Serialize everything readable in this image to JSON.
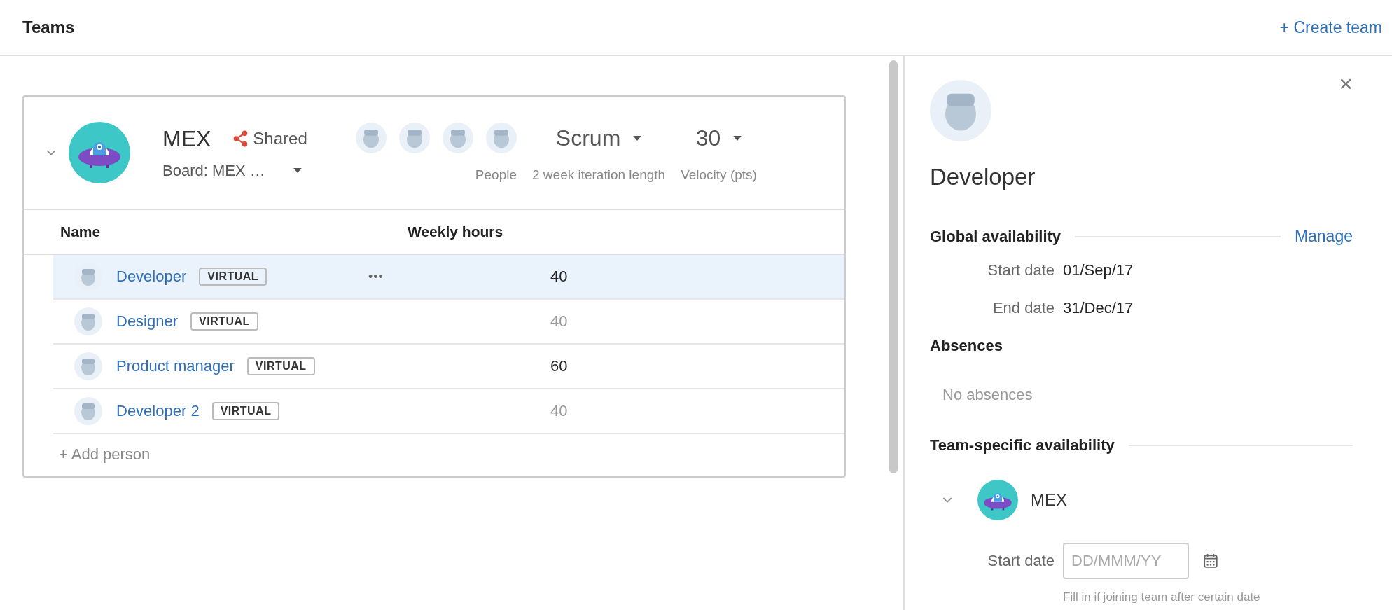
{
  "header": {
    "title": "Teams",
    "create_button": "+ Create team"
  },
  "team": {
    "name": "MEX",
    "expanded": true,
    "shared_label": "Shared",
    "board": "Board: MEX …",
    "people_label": "People",
    "method": "Scrum",
    "method_label": "2 week iteration length",
    "velocity": "30",
    "velocity_label": "Velocity (pts)",
    "columns": [
      "Name",
      "Weekly hours"
    ],
    "rows": [
      {
        "name": "Developer",
        "tag": "VIRTUAL",
        "actions": "•••",
        "hours": "40",
        "muted": false,
        "selected": true
      },
      {
        "name": "Designer",
        "tag": "VIRTUAL",
        "hours": "40",
        "muted": true,
        "selected": false
      },
      {
        "name": "Product manager",
        "tag": "VIRTUAL",
        "hours": "60",
        "muted": false,
        "selected": false
      },
      {
        "name": "Developer 2",
        "tag": "VIRTUAL",
        "hours": "40",
        "muted": true,
        "selected": false
      }
    ],
    "add_person": "+ Add person"
  },
  "panel": {
    "close": "×",
    "name": "Developer",
    "global": {
      "title": "Global availability",
      "manage": "Manage",
      "fields": [
        {
          "label": "Start date",
          "value": "01/Sep/17"
        },
        {
          "label": "End date",
          "value": "31/Dec/17"
        }
      ]
    },
    "absences": {
      "title": "Absences",
      "empty": "No absences"
    },
    "team_specific": {
      "title": "Team-specific availability",
      "team": "MEX",
      "expanded": true,
      "start_label": "Start date",
      "placeholder": "DD/MMM/YY",
      "hint": "Fill in if joining team after certain date"
    }
  }
}
